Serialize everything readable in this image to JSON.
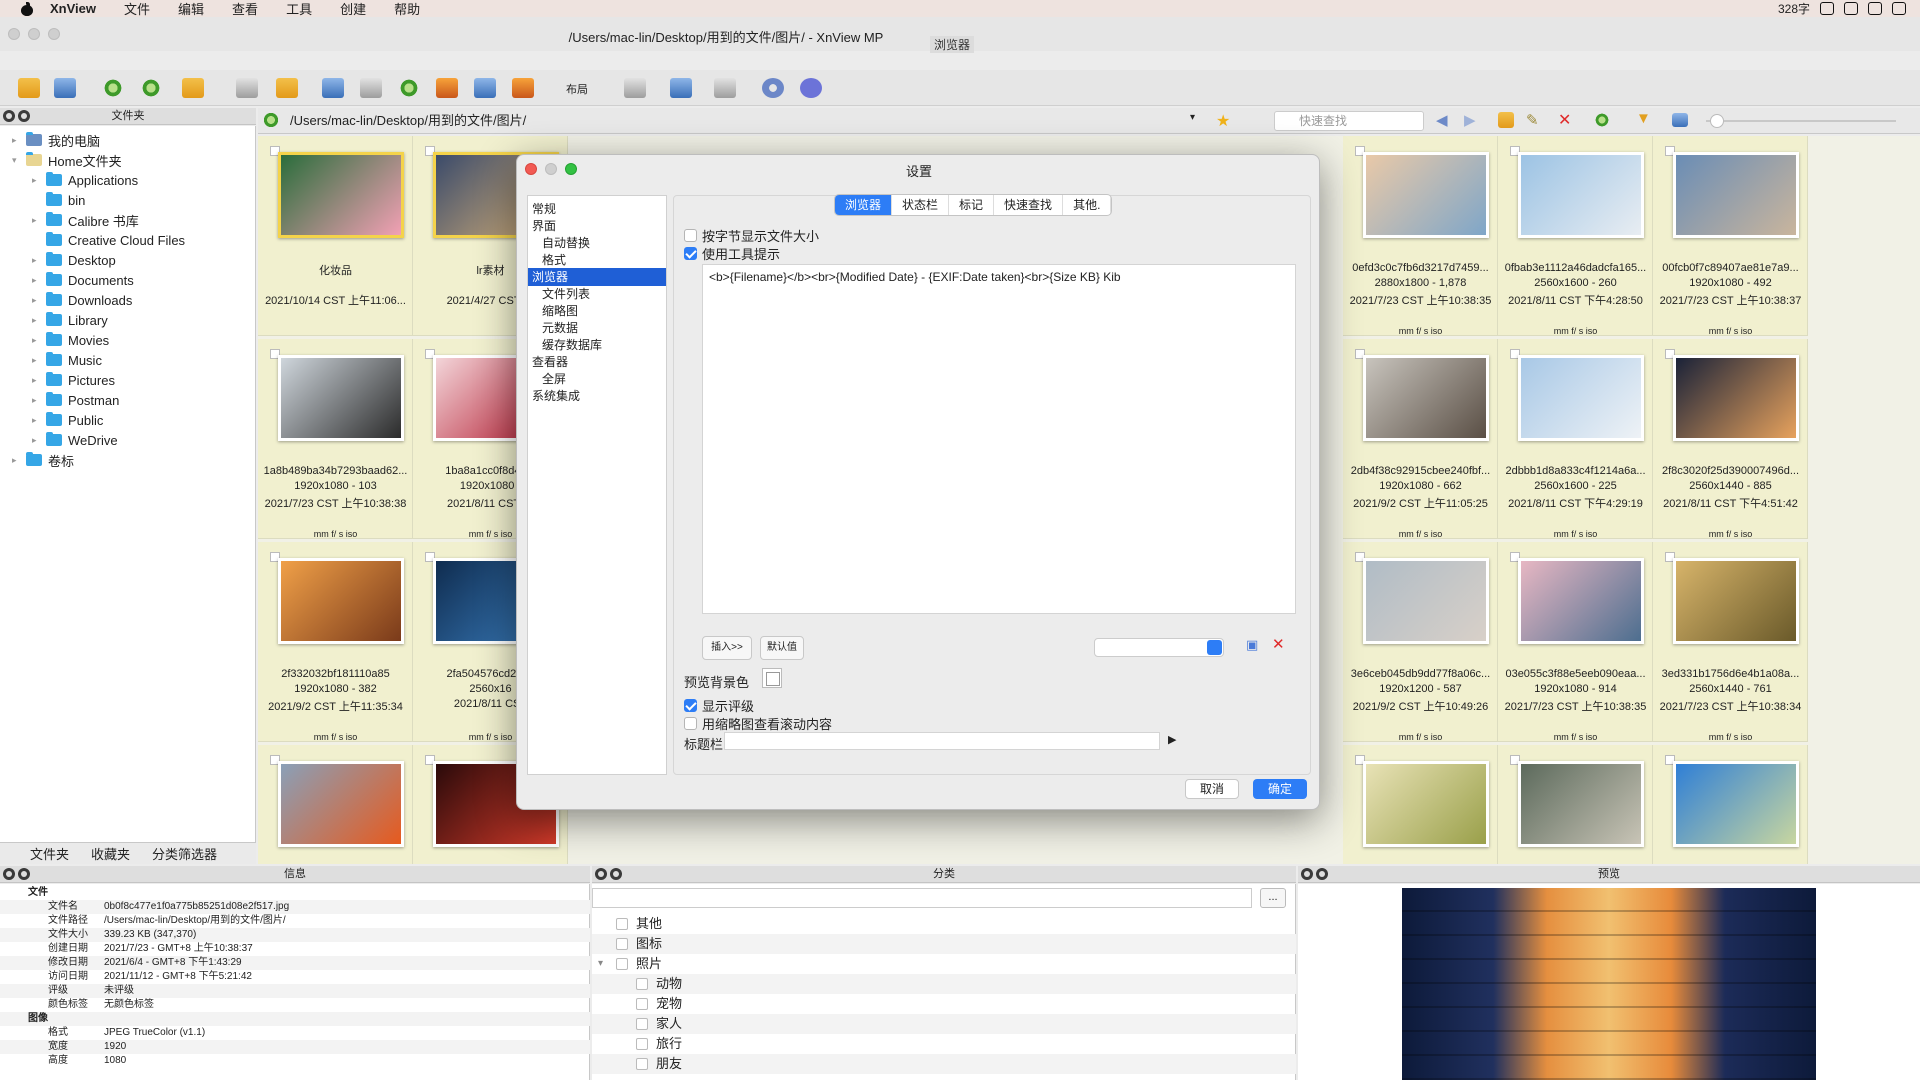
{
  "menubar": {
    "app": "XnView",
    "items": [
      "文件",
      "编辑",
      "查看",
      "工具",
      "创建",
      "帮助"
    ],
    "status_text": "328字"
  },
  "window": {
    "title": "/Users/mac-lin/Desktop/用到的文件/图片/ - XnView MP",
    "subtitle": "浏览器"
  },
  "toolbar": {
    "layout_label": "布局"
  },
  "folder_panel": {
    "title": "文件夹",
    "items": [
      {
        "label": "我的电脑",
        "level": 0,
        "expand": "▸"
      },
      {
        "label": "Home文件夹",
        "level": 0,
        "expand": "▾"
      },
      {
        "label": "Applications",
        "level": 1,
        "expand": "▸"
      },
      {
        "label": "bin",
        "level": 1,
        "expand": ""
      },
      {
        "label": "Calibre 书库",
        "level": 1,
        "expand": "▸"
      },
      {
        "label": "Creative Cloud Files",
        "level": 1,
        "expand": ""
      },
      {
        "label": "Desktop",
        "level": 1,
        "expand": "▸"
      },
      {
        "label": "Documents",
        "level": 1,
        "expand": "▸"
      },
      {
        "label": "Downloads",
        "level": 1,
        "expand": "▸"
      },
      {
        "label": "Library",
        "level": 1,
        "expand": "▸"
      },
      {
        "label": "Movies",
        "level": 1,
        "expand": "▸"
      },
      {
        "label": "Music",
        "level": 1,
        "expand": "▸"
      },
      {
        "label": "Pictures",
        "level": 1,
        "expand": "▸"
      },
      {
        "label": "Postman",
        "level": 1,
        "expand": "▸"
      },
      {
        "label": "Public",
        "level": 1,
        "expand": "▸"
      },
      {
        "label": "WeDrive",
        "level": 1,
        "expand": "▸"
      },
      {
        "label": "卷标",
        "level": 0,
        "expand": "▸"
      }
    ],
    "tabs": [
      "文件夹",
      "收藏夹",
      "分类筛选器"
    ]
  },
  "address": {
    "path": "/Users/mac-lin/Desktop/用到的文件/图片/",
    "search_placeholder": "快速查找"
  },
  "thumbnails": [
    {
      "col": 0,
      "row": 0,
      "l1": "化妆品",
      "l2": "",
      "l3": "2021/10/14 CST 上午11:06...",
      "l4": "",
      "c1": "#2a6d3b",
      "c2": "#f2a0b4",
      "sel": true
    },
    {
      "col": 1,
      "row": 0,
      "l1": "lr素材",
      "l2": "",
      "l3": "2021/4/27 CST 下",
      "l4": "",
      "c1": "#3b4b6a",
      "c2": "#d7b27a",
      "sel": true
    },
    {
      "col": 7,
      "row": 0,
      "l1": "0efd3c0c7fb6d3217d7459...",
      "l2": "2880x1800 - 1,878",
      "l3": "2021/7/23 CST 上午10:38:35",
      "l4": "mm f/ s iso",
      "c1": "#e9c9a8",
      "c2": "#7fa6c8"
    },
    {
      "col": 8,
      "row": 0,
      "l1": "0fbab3e1112a46dadcfa165...",
      "l2": "2560x1600 - 260",
      "l3": "2021/8/11 CST 下午4:28:50",
      "l4": "mm f/ s iso",
      "c1": "#9cc3e4",
      "c2": "#e8edf2"
    },
    {
      "col": 9,
      "row": 0,
      "l1": "00fcb0f7c89407ae81e7a9...",
      "l2": "1920x1080 - 492",
      "l3": "2021/7/23 CST 上午10:38:37",
      "l4": "mm f/ s iso",
      "c1": "#6a8db5",
      "c2": "#c9b59d"
    },
    {
      "col": 0,
      "row": 1,
      "l1": "1a8b489ba34b7293baad62...",
      "l2": "1920x1080 - 103",
      "l3": "2021/7/23 CST 上午10:38:38",
      "l4": "mm f/ s iso",
      "c1": "#cfd6dc",
      "c2": "#2b2b2b"
    },
    {
      "col": 1,
      "row": 1,
      "l1": "1ba8a1cc0f8d409f",
      "l2": "1920x1080 -",
      "l3": "2021/8/11 CST 下",
      "l4": "mm f/ s iso",
      "c1": "#f3d5d9",
      "c2": "#b3192e"
    },
    {
      "col": 7,
      "row": 1,
      "l1": "2db4f38c92915cbee240fbf...",
      "l2": "1920x1080 - 662",
      "l3": "2021/9/2 CST 上午11:05:25",
      "l4": "mm f/ s iso",
      "c1": "#c8c4bd",
      "c2": "#5a4f45"
    },
    {
      "col": 8,
      "row": 1,
      "l1": "2dbbb1d8a833c4f1214a6a...",
      "l2": "2560x1600 - 225",
      "l3": "2021/8/11 CST 下午4:29:19",
      "l4": "mm f/ s iso",
      "c1": "#a8c8e6",
      "c2": "#eef2f6"
    },
    {
      "col": 9,
      "row": 1,
      "l1": "2f8c3020f25d390007496d...",
      "l2": "2560x1440 - 885",
      "l3": "2021/8/11 CST 下午4:51:42",
      "l4": "mm f/ s iso",
      "c1": "#1a2238",
      "c2": "#e7a25d"
    },
    {
      "col": 0,
      "row": 2,
      "l1": "2f332032bf181110a85",
      "l2": "1920x1080 - 382",
      "l3": "2021/9/2 CST 上午11:35:34",
      "l4": "mm f/ s iso",
      "c1": "#f0a048",
      "c2": "#7a3a1a"
    },
    {
      "col": 1,
      "row": 2,
      "l1": "2fa504576cd2796",
      "l2": "2560x16",
      "l3": "2021/8/11 CST",
      "l4": "mm f/ s iso",
      "c1": "#0f2c4f",
      "c2": "#3b7fc0"
    },
    {
      "col": 7,
      "row": 2,
      "l1": "3e6ceb045db9dd77f8a06c...",
      "l2": "1920x1200 - 587",
      "l3": "2021/9/2 CST 上午10:49:26",
      "l4": "mm f/ s iso",
      "c1": "#b0bcc6",
      "c2": "#d8d0c8"
    },
    {
      "col": 8,
      "row": 2,
      "l1": "03e055c3f88e5eeb090eaa...",
      "l2": "1920x1080 - 914",
      "l3": "2021/7/23 CST 上午10:38:35",
      "l4": "mm f/ s iso",
      "c1": "#e7b7c3",
      "c2": "#4d6e8f"
    },
    {
      "col": 9,
      "row": 2,
      "l1": "3ed331b1756d6e4b1a08a...",
      "l2": "2560x1440 - 761",
      "l3": "2021/7/23 CST 上午10:38:34",
      "l4": "mm f/ s iso",
      "c1": "#d7b46a",
      "c2": "#6a5a2a"
    },
    {
      "col": 0,
      "row": 3,
      "l1": "",
      "l2": "",
      "l3": "",
      "l4": "",
      "c1": "#8aa0b8",
      "c2": "#e65a1e"
    },
    {
      "col": 1,
      "row": 3,
      "l1": "",
      "l2": "",
      "l3": "",
      "l4": "",
      "c1": "#2a0a0a",
      "c2": "#d23a2a"
    },
    {
      "col": 7,
      "row": 3,
      "l1": "",
      "l2": "",
      "l3": "",
      "l4": "",
      "c1": "#e8e2b6",
      "c2": "#9aa04a"
    },
    {
      "col": 8,
      "row": 3,
      "l1": "",
      "l2": "",
      "l3": "",
      "l4": "",
      "c1": "#5c6a5c",
      "c2": "#c8c4b6"
    },
    {
      "col": 9,
      "row": 3,
      "l1": "",
      "l2": "",
      "l3": "",
      "l4": "",
      "c1": "#2f7fd6",
      "c2": "#c8d6a0"
    }
  ],
  "info_panel": {
    "title": "信息",
    "rows": [
      {
        "k": "文件",
        "v": "",
        "group": true
      },
      {
        "k": "文件名",
        "v": "0b0f8c477e1f0a775b85251d08e2f517.jpg"
      },
      {
        "k": "文件路径",
        "v": "/Users/mac-lin/Desktop/用到的文件/图片/"
      },
      {
        "k": "文件大小",
        "v": "339.23 KB (347,370)"
      },
      {
        "k": "创建日期",
        "v": "2021/7/23 - GMT+8 上午10:38:37"
      },
      {
        "k": "修改日期",
        "v": "2021/6/4 - GMT+8 下午1:43:29"
      },
      {
        "k": "访问日期",
        "v": "2021/11/12 - GMT+8 下午5:21:42"
      },
      {
        "k": "评级",
        "v": "未评级"
      },
      {
        "k": "颜色标签",
        "v": "无颜色标签"
      },
      {
        "k": "图像",
        "v": "",
        "group": true
      },
      {
        "k": "格式",
        "v": "JPEG TrueColor (v1.1)"
      },
      {
        "k": "宽度",
        "v": "1920"
      },
      {
        "k": "高度",
        "v": "1080"
      }
    ]
  },
  "category_panel": {
    "title": "分类",
    "button": "...",
    "rows": [
      {
        "label": "其他",
        "indent": 0
      },
      {
        "label": "图标",
        "indent": 0
      },
      {
        "label": "照片",
        "indent": 0,
        "expand": "▾"
      },
      {
        "label": "动物",
        "indent": 1
      },
      {
        "label": "宠物",
        "indent": 1
      },
      {
        "label": "家人",
        "indent": 1
      },
      {
        "label": "旅行",
        "indent": 1
      },
      {
        "label": "朋友",
        "indent": 1
      }
    ]
  },
  "preview_panel": {
    "title": "预览"
  },
  "dialog": {
    "title": "设置",
    "nav": [
      {
        "label": "常规",
        "indent": 0
      },
      {
        "label": "界面",
        "indent": 0
      },
      {
        "label": "自动替换",
        "indent": 1
      },
      {
        "label": "格式",
        "indent": 1
      },
      {
        "label": "浏览器",
        "indent": 0,
        "sel": true
      },
      {
        "label": "文件列表",
        "indent": 1
      },
      {
        "label": "缩略图",
        "indent": 1
      },
      {
        "label": "元数据",
        "indent": 1
      },
      {
        "label": "缓存数据库",
        "indent": 1
      },
      {
        "label": "查看器",
        "indent": 0
      },
      {
        "label": "全屏",
        "indent": 1
      },
      {
        "label": "系统集成",
        "indent": 0
      }
    ],
    "tabs": [
      {
        "label": "浏览器",
        "active": true
      },
      {
        "label": "状态栏"
      },
      {
        "label": "标记"
      },
      {
        "label": "快速查找"
      },
      {
        "label": "其他."
      }
    ],
    "option_bytes": "按字节显示文件大小",
    "option_tooltip": "使用工具提示",
    "tooltip_template": "<b>{Filename}</b><br>{Modified Date} - {EXIF:Date taken}<br>{Size KB} Kib",
    "insert_button": "插入>>",
    "default_button": "默认值",
    "preview_bg_label": "预览背景色",
    "show_rating": "显示评级",
    "thumb_scroll": "用缩略图查看滚动内容",
    "title_bar_label": "标题栏",
    "cancel": "取消",
    "ok": "确定"
  }
}
